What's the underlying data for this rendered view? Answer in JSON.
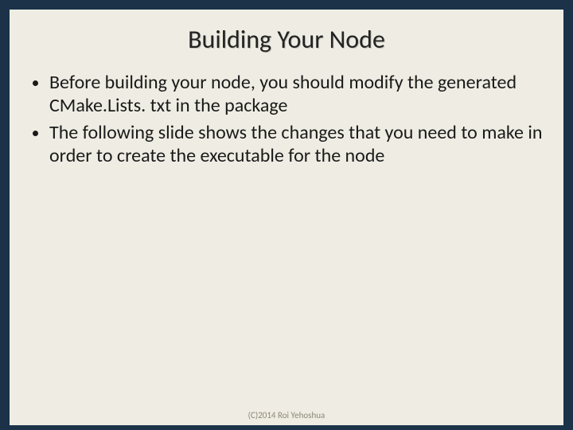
{
  "slide": {
    "title": "Building Your Node",
    "bullets": [
      "Before building your node, you should modify the generated CMake.Lists. txt in the package",
      "The following slide shows the changes that you need to make in order to create the executable for the node"
    ],
    "footer": "(C)2014 Roi Yehoshua"
  }
}
